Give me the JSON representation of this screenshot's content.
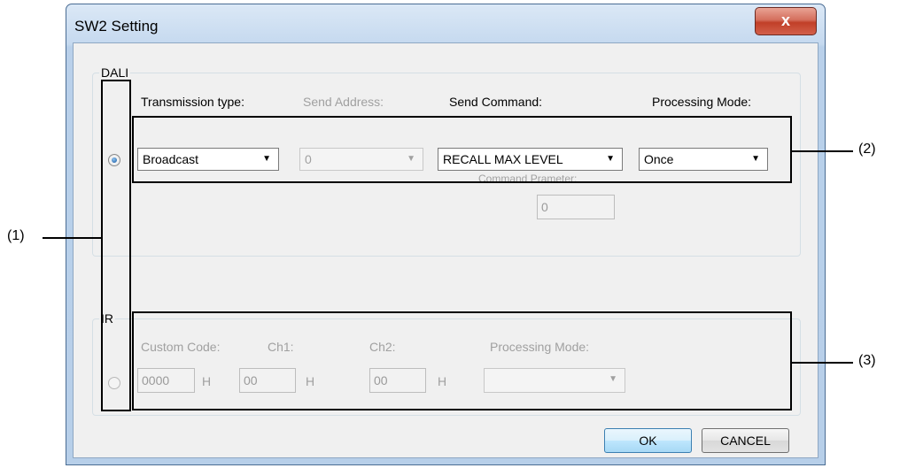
{
  "window": {
    "title": "SW2 Setting",
    "close_glyph": "x"
  },
  "dali": {
    "group_label": "DALI",
    "radio_selected": true,
    "transmission_type": {
      "label": "Transmission type:",
      "value": "Broadcast"
    },
    "send_address": {
      "label": "Send Address:",
      "value": "0"
    },
    "send_command": {
      "label": "Send Command:",
      "value": "RECALL MAX LEVEL"
    },
    "processing_mode": {
      "label": "Processing Mode:",
      "value": "Once"
    },
    "command_parameter": {
      "label": "Command Prameter:",
      "value": "0"
    }
  },
  "ir": {
    "group_label": "IR",
    "radio_selected": false,
    "custom_code": {
      "label": "Custom Code:",
      "value": "0000",
      "unit": "H"
    },
    "ch1": {
      "label": "Ch1:",
      "value": "00",
      "unit": "H"
    },
    "ch2": {
      "label": "Ch2:",
      "value": "00",
      "unit": "H"
    },
    "processing_mode": {
      "label": "Processing Mode:",
      "value": ""
    }
  },
  "buttons": {
    "ok": "OK",
    "cancel": "CANCEL"
  },
  "annotations": {
    "one": "(1)",
    "two": "(2)",
    "three": "(3)"
  },
  "icons": {
    "dropdown": "chevron-down-icon",
    "close": "close-icon"
  },
  "colors": {
    "title_bar": "#c5d9ef",
    "client_bg": "#f0f0f0",
    "close_button": "#c13f28",
    "disabled_text": "#a0a0a0"
  }
}
